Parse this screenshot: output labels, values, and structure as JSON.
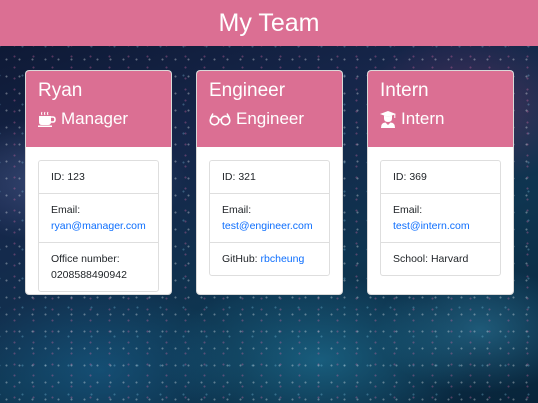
{
  "header": {
    "title": "My Team"
  },
  "cards": [
    {
      "name": "Ryan",
      "role": "Manager",
      "icon": "coffee-icon",
      "id_label": "ID: 123",
      "email_label": "Email:",
      "email": "ryan@manager.com",
      "extra_label": "Office number:",
      "extra_value": "0208588490942"
    },
    {
      "name": "Engineer",
      "role": "Engineer",
      "icon": "glasses-icon",
      "id_label": "ID: 321",
      "email_label": "Email:",
      "email": "test@engineer.com",
      "extra_label": "GitHub:",
      "extra_value": "rbcheung"
    },
    {
      "name": "Intern",
      "role": "Intern",
      "icon": "graduate-icon",
      "id_label": "ID: 369",
      "email_label": "Email:",
      "email": "test@intern.com",
      "extra_label": "School: Harvard"
    }
  ],
  "colors": {
    "accent": "#db6f93",
    "link": "#0d6efd"
  }
}
